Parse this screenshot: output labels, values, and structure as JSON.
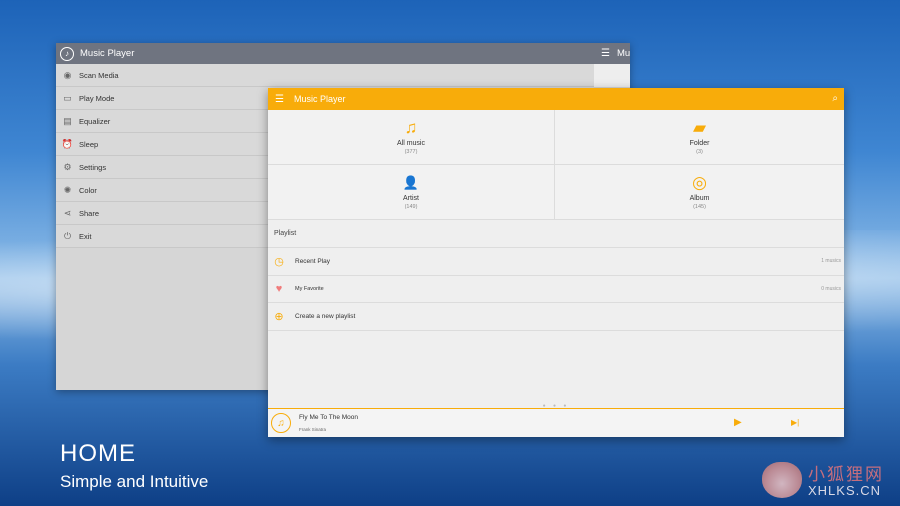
{
  "back_window": {
    "title": "Music Player",
    "title_clipped": "Mu",
    "drawer": [
      {
        "icon": "scan-icon",
        "glyph": "◉",
        "label": "Scan Media"
      },
      {
        "icon": "play-mode-icon",
        "glyph": "▭",
        "label": "Play Mode"
      },
      {
        "icon": "equalizer-icon",
        "glyph": "▤",
        "label": "Equalizer"
      },
      {
        "icon": "alarm-clock-icon",
        "glyph": "⏰",
        "label": "Sleep"
      },
      {
        "icon": "gear-icon",
        "glyph": "⚙",
        "label": "Settings"
      },
      {
        "icon": "palette-icon",
        "glyph": "✺",
        "label": "Color"
      },
      {
        "icon": "share-icon",
        "glyph": "⋖",
        "label": "Share"
      },
      {
        "icon": "power-icon",
        "glyph": "⏻",
        "label": "Exit"
      }
    ]
  },
  "front_window": {
    "title": "Music Player",
    "categories": [
      {
        "icon": "music-note-icon",
        "glyph": "♫",
        "label": "All music",
        "count": "(377)"
      },
      {
        "icon": "folder-icon",
        "glyph": "▰",
        "label": "Folder",
        "count": "(3)"
      },
      {
        "icon": "person-icon",
        "glyph": "👤",
        "label": "Artist",
        "count": "(149)"
      },
      {
        "icon": "disc-icon",
        "glyph": "◎",
        "label": "Album",
        "count": "(145)"
      }
    ],
    "playlist_header": "Playlist",
    "playlists": [
      {
        "icon": "clock-icon",
        "glyph": "◷",
        "label": "Recent Play",
        "count": "1 musics"
      },
      {
        "icon": "heart-icon",
        "glyph": "♥",
        "label": "My Favorite",
        "count": "0 musics"
      },
      {
        "icon": "plus-circle-icon",
        "glyph": "⊕",
        "label": "Create a new playlist",
        "count": ""
      }
    ],
    "now_playing": {
      "title": "Fly Me To The Moon",
      "artist": "Frank Sinatra"
    }
  },
  "caption": {
    "title": "HOME",
    "subtitle": "Simple and Intuitive"
  },
  "watermark": {
    "cn": "小狐狸网",
    "en": "XHLKS.CN"
  },
  "colors": {
    "accent": "#f8ac0a",
    "back_bar": "#6f7480"
  }
}
